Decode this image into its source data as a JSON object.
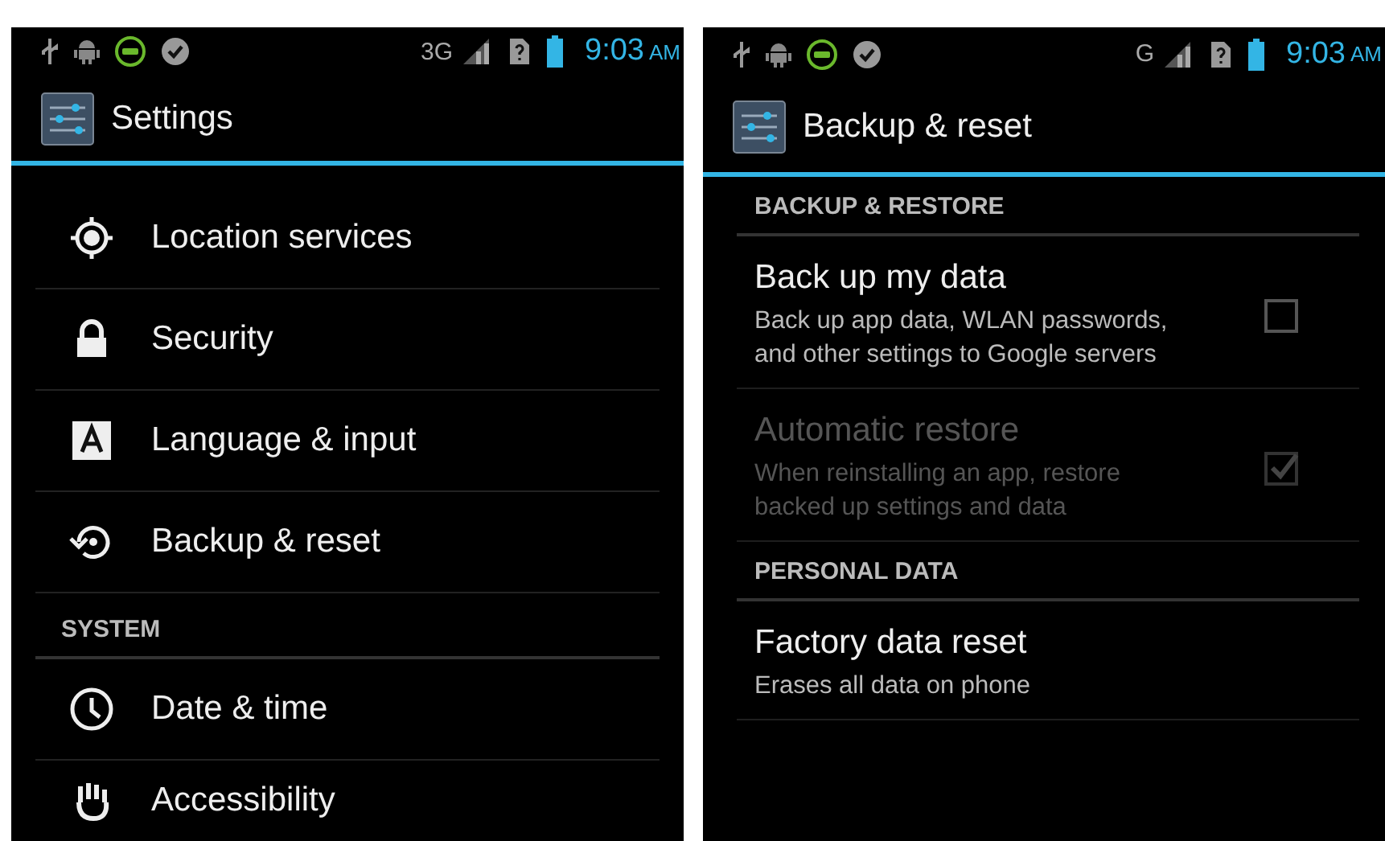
{
  "screens": [
    {
      "status_bar": {
        "network": "3G",
        "time": "9:03",
        "meridiem": "AM"
      },
      "title": "Settings",
      "items": [
        {
          "kind": "location",
          "label": "Location services"
        },
        {
          "kind": "security",
          "label": "Security"
        },
        {
          "kind": "language",
          "label": "Language & input"
        },
        {
          "kind": "backup",
          "label": "Backup & reset"
        },
        {
          "kind": "header",
          "label": "SYSTEM"
        },
        {
          "kind": "datetime",
          "label": "Date & time"
        },
        {
          "kind": "accessibility",
          "label": "Accessibility"
        }
      ]
    },
    {
      "status_bar": {
        "network": "G",
        "time": "9:03",
        "meridiem": "AM"
      },
      "title": "Backup & reset",
      "items": [
        {
          "kind": "header",
          "label": "BACKUP & RESTORE"
        },
        {
          "kind": "checkbox",
          "label": "Back up my data",
          "summary": "Back up app data, WLAN passwords, and other settings to Google servers",
          "checked": false,
          "disabled": false
        },
        {
          "kind": "checkbox",
          "label": "Automatic restore",
          "summary": "When reinstalling an app, restore backed up settings and data",
          "checked": true,
          "disabled": true
        },
        {
          "kind": "header",
          "label": "PERSONAL DATA"
        },
        {
          "kind": "action",
          "label": "Factory data reset",
          "summary": "Erases all data on phone"
        }
      ]
    }
  ]
}
